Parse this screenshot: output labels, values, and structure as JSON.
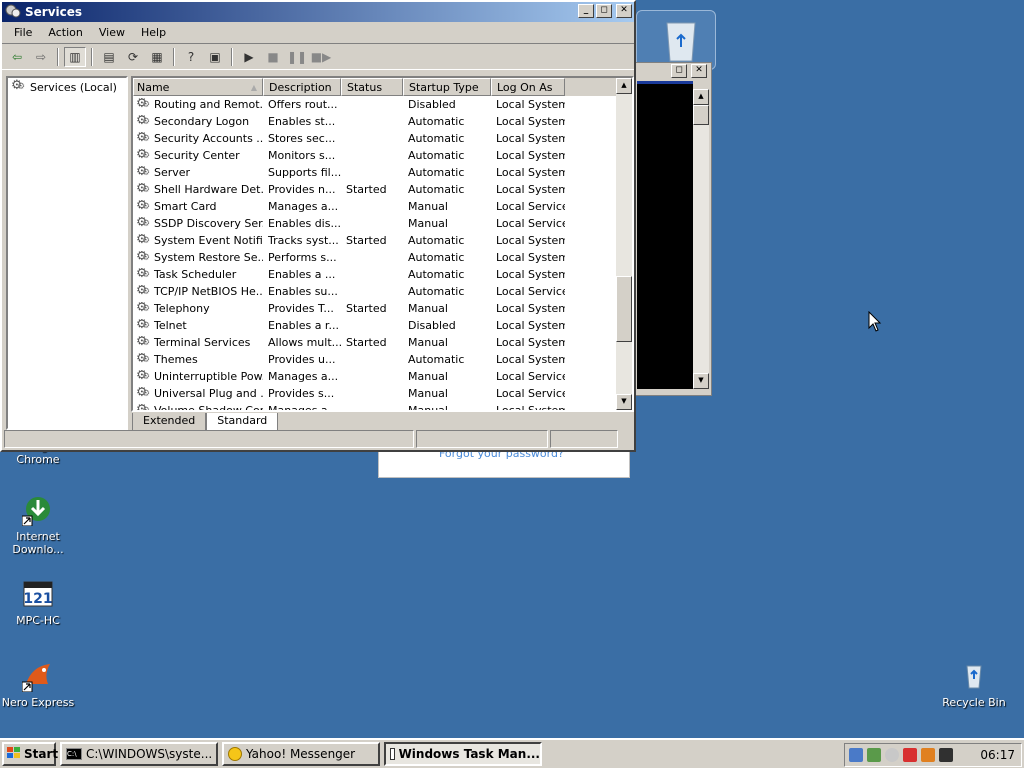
{
  "window": {
    "title": "Services",
    "menu": [
      "File",
      "Action",
      "View",
      "Help"
    ]
  },
  "tree": {
    "root": "Services (Local)"
  },
  "columns": [
    "Name",
    "Description",
    "Status",
    "Startup Type",
    "Log On As"
  ],
  "services": [
    [
      "Routing and Remot...",
      "Offers rout...",
      "",
      "Disabled",
      "Local System"
    ],
    [
      "Secondary Logon",
      "Enables st...",
      "",
      "Automatic",
      "Local System"
    ],
    [
      "Security Accounts ...",
      "Stores sec...",
      "",
      "Automatic",
      "Local System"
    ],
    [
      "Security Center",
      "Monitors s...",
      "",
      "Automatic",
      "Local System"
    ],
    [
      "Server",
      "Supports fil...",
      "",
      "Automatic",
      "Local System"
    ],
    [
      "Shell Hardware Det...",
      "Provides n...",
      "Started",
      "Automatic",
      "Local System"
    ],
    [
      "Smart Card",
      "Manages a...",
      "",
      "Manual",
      "Local Service"
    ],
    [
      "SSDP Discovery Ser...",
      "Enables dis...",
      "",
      "Manual",
      "Local Service"
    ],
    [
      "System Event Notifi...",
      "Tracks syst...",
      "Started",
      "Automatic",
      "Local System"
    ],
    [
      "System Restore Se...",
      "Performs s...",
      "",
      "Automatic",
      "Local System"
    ],
    [
      "Task Scheduler",
      "Enables a ...",
      "",
      "Automatic",
      "Local System"
    ],
    [
      "TCP/IP NetBIOS He...",
      "Enables su...",
      "",
      "Automatic",
      "Local Service"
    ],
    [
      "Telephony",
      "Provides T...",
      "Started",
      "Manual",
      "Local System"
    ],
    [
      "Telnet",
      "Enables a r...",
      "",
      "Disabled",
      "Local System"
    ],
    [
      "Terminal Services",
      "Allows mult...",
      "Started",
      "Manual",
      "Local System"
    ],
    [
      "Themes",
      "Provides u...",
      "",
      "Automatic",
      "Local System"
    ],
    [
      "Uninterruptible Pow...",
      "Manages a...",
      "",
      "Manual",
      "Local Service"
    ],
    [
      "Universal Plug and ...",
      "Provides s...",
      "",
      "Manual",
      "Local Service"
    ],
    [
      "Volume Shadow Copy",
      "Manages a...",
      "",
      "Manual",
      "Local System"
    ]
  ],
  "tabs": [
    "Extended",
    "Standard"
  ],
  "desktop": {
    "icons": [
      "Google Chrome",
      "Internet Downlo...",
      "MPC-HC",
      "Nero Express",
      "Recycle Bin"
    ]
  },
  "background_login": {
    "forgot_link": "Forgot your password?"
  },
  "taskbar": {
    "start": "Start",
    "tasks": [
      "C:\\WINDOWS\\syste...",
      "Yahoo! Messenger",
      "Windows Task Man..."
    ],
    "clock": "06:17"
  },
  "colors": {
    "desktop": "#3a6ea5",
    "title_start": "#0a246a",
    "title_end": "#a6caf0",
    "chrome": "#d4d0c8"
  }
}
